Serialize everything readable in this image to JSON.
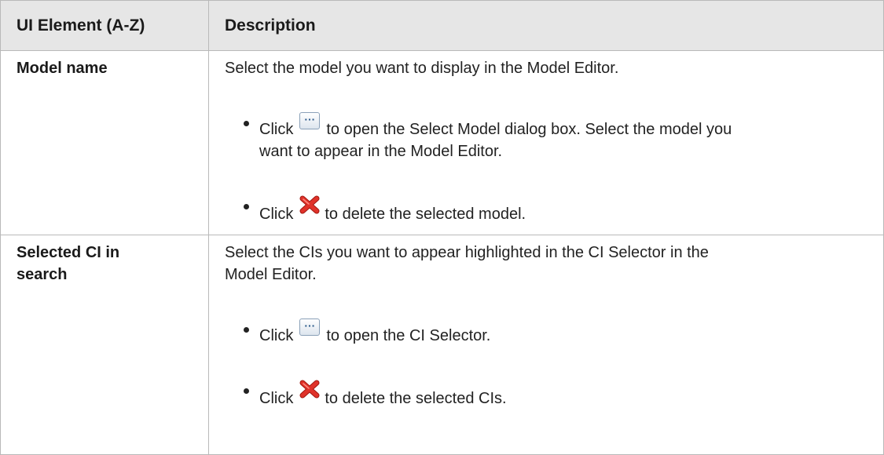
{
  "table": {
    "col1_header": "UI Element (A-Z)",
    "col2_header": "Description",
    "rows": [
      {
        "name": "Model name",
        "intro": "Select the model you want to display in the Model Editor.",
        "bullet1": {
          "click": "Click",
          "icon": "ellipsis-button-icon",
          "rest_line1": "to open the Select Model dialog box. Select the model you",
          "rest_line2": "want to appear in the Model Editor."
        },
        "bullet2": {
          "click": "Click",
          "icon": "red-x-delete-icon",
          "rest": "to delete the selected model."
        }
      },
      {
        "name_line1": "Selected CI in",
        "name_line2": "search",
        "intro_line1": "Select the CIs you want to appear highlighted in the CI Selector in the",
        "intro_line2": "Model Editor.",
        "bullet1": {
          "click": "Click",
          "icon": "ellipsis-button-icon",
          "rest": "to open the CI Selector."
        },
        "bullet2": {
          "click": "Click",
          "icon": "red-x-delete-icon",
          "rest": "to delete the selected CIs."
        }
      }
    ]
  },
  "colors": {
    "header_bg": "#e6e6e6",
    "border": "#b9b9b9",
    "delete_icon": "#e0322a"
  }
}
